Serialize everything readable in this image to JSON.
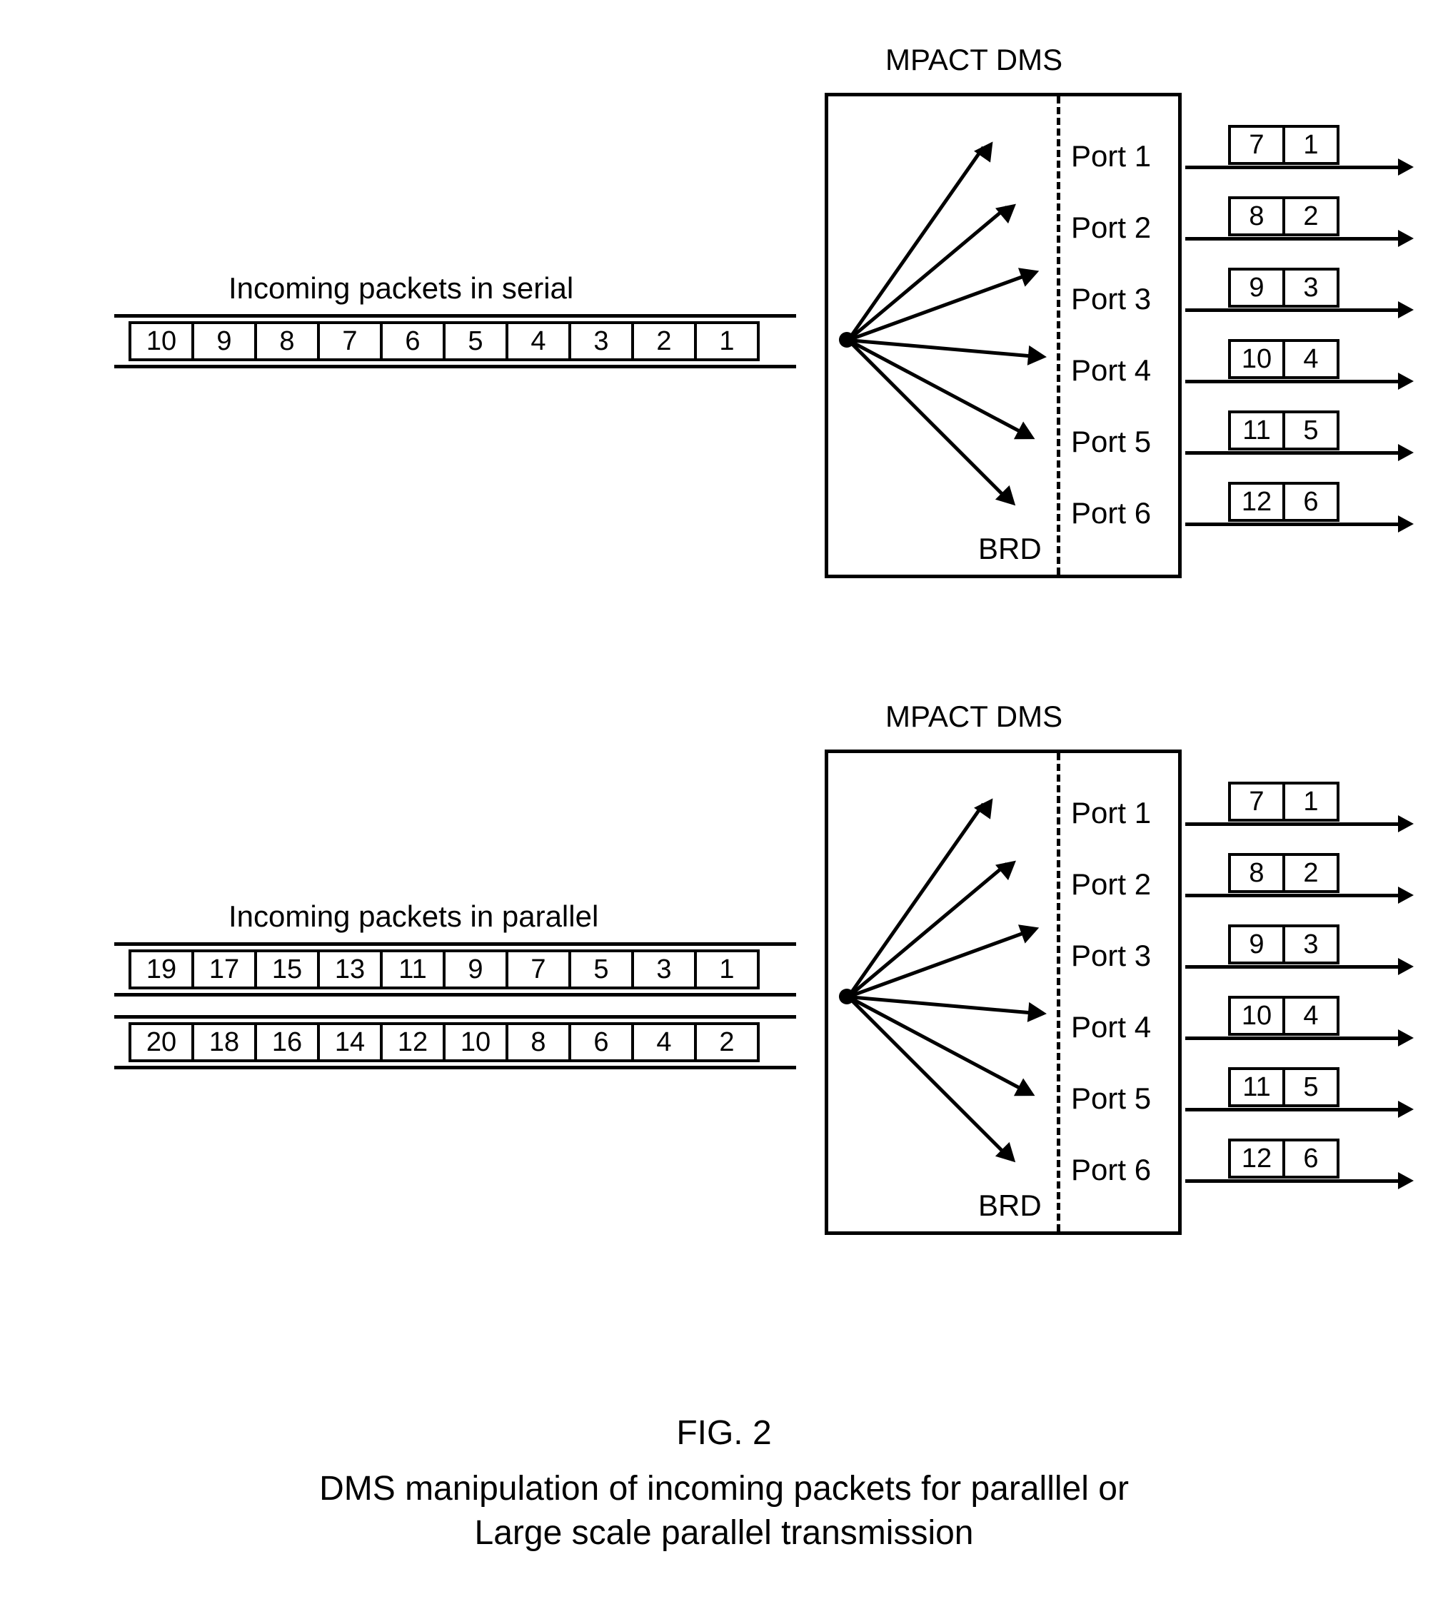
{
  "sections": [
    {
      "dms_title": "MPACT DMS",
      "brd_label": "BRD",
      "incoming_label": "Incoming packets in serial",
      "rows": [
        {
          "packets": [
            "10",
            "9",
            "8",
            "7",
            "6",
            "5",
            "4",
            "3",
            "2",
            "1"
          ]
        }
      ],
      "ports": [
        "Port 1",
        "Port 2",
        "Port 3",
        "Port 4",
        "Port 5",
        "Port 6"
      ],
      "outputs": [
        [
          "7",
          "1"
        ],
        [
          "8",
          "2"
        ],
        [
          "9",
          "3"
        ],
        [
          "10",
          "4"
        ],
        [
          "11",
          "5"
        ],
        [
          "12",
          "6"
        ]
      ]
    },
    {
      "dms_title": "MPACT DMS",
      "brd_label": "BRD",
      "incoming_label": "Incoming packets in parallel",
      "rows": [
        {
          "packets": [
            "19",
            "17",
            "15",
            "13",
            "11",
            "9",
            "7",
            "5",
            "3",
            "1"
          ]
        },
        {
          "packets": [
            "20",
            "18",
            "16",
            "14",
            "12",
            "10",
            "8",
            "6",
            "4",
            "2"
          ]
        }
      ],
      "ports": [
        "Port 1",
        "Port 2",
        "Port 3",
        "Port 4",
        "Port 5",
        "Port 6"
      ],
      "outputs": [
        [
          "7",
          "1"
        ],
        [
          "8",
          "2"
        ],
        [
          "9",
          "3"
        ],
        [
          "10",
          "4"
        ],
        [
          "11",
          "5"
        ],
        [
          "12",
          "6"
        ]
      ]
    }
  ],
  "caption": {
    "fig": "FIG. 2",
    "line1": "DMS manipulation of incoming packets for paralllel or",
    "line2": "Large scale parallel transmission"
  }
}
